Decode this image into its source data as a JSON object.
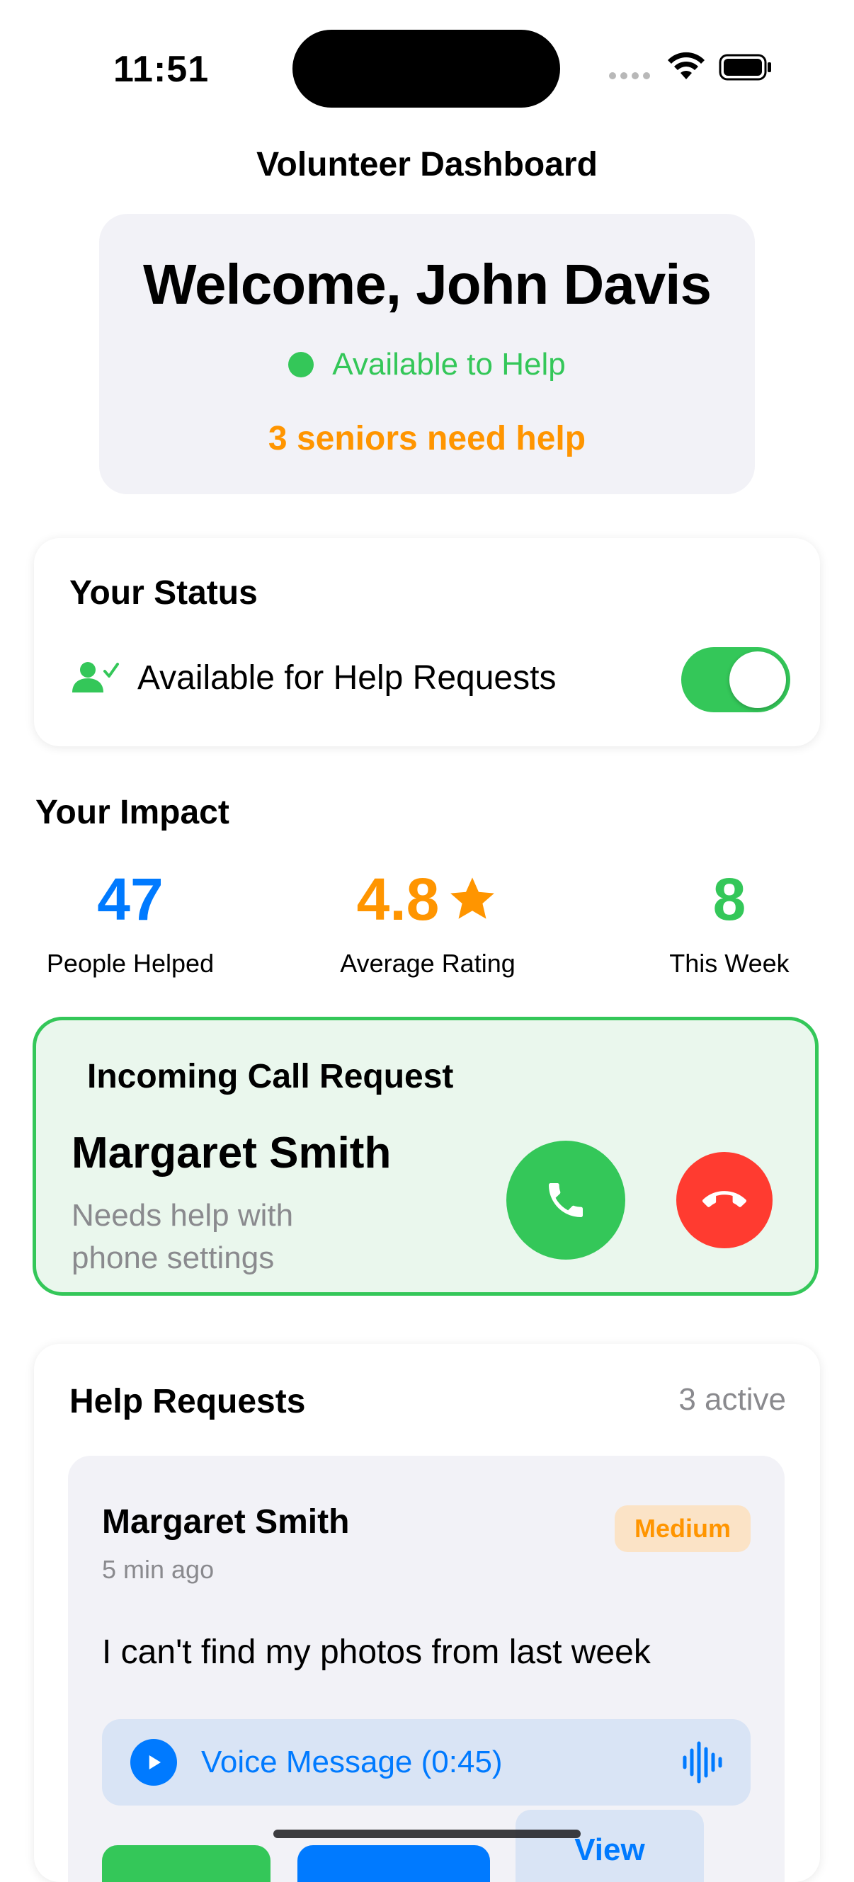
{
  "status_bar": {
    "time": "11:51"
  },
  "nav": {
    "title": "Volunteer Dashboard"
  },
  "welcome": {
    "greeting": "Welcome, John Davis",
    "availability": "Available to Help",
    "seniors_need_help": "3 seniors need help"
  },
  "status": {
    "title": "Your Status",
    "toggle_label": "Available for Help Requests",
    "toggle_on": true
  },
  "impact": {
    "title": "Your Impact",
    "stats": [
      {
        "value": "47",
        "label": "People Helped",
        "color": "#007aff"
      },
      {
        "value": "4.8",
        "label": "Average Rating",
        "color": "#ff9500",
        "icon": "star-icon"
      },
      {
        "value": "8",
        "label": "This Week",
        "color": "#34c759"
      }
    ]
  },
  "incoming_call": {
    "title": "Incoming Call Request",
    "caller": "Margaret Smith",
    "description": "Needs help with phone settings"
  },
  "help_requests": {
    "title": "Help Requests",
    "count": "3 active",
    "items": [
      {
        "name": "Margaret Smith",
        "time": "5 min ago",
        "priority": "Medium",
        "message": "I can't find my photos from last week",
        "voice_label": "Voice Message (0:45)",
        "view_label": "View"
      }
    ]
  },
  "colors": {
    "green": "#34c759",
    "orange": "#ff9500",
    "blue": "#007aff",
    "red": "#ff3b30",
    "card_gray": "#f2f2f7"
  }
}
